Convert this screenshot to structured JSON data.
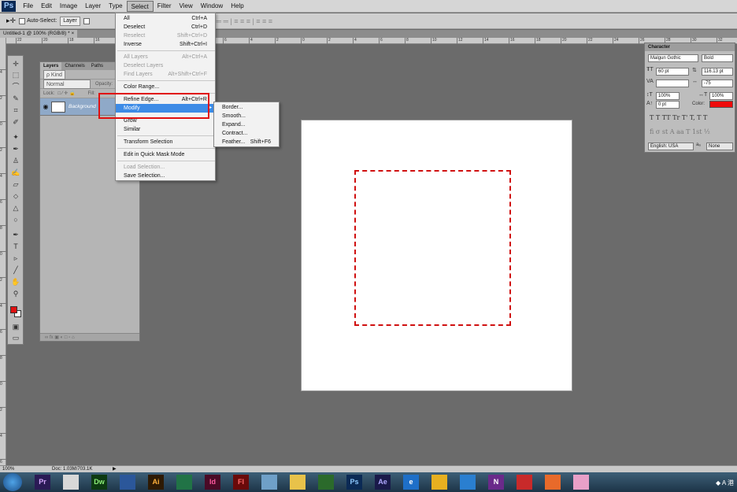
{
  "app": {
    "logo": "Ps"
  },
  "menubar": [
    "File",
    "Edit",
    "Image",
    "Layer",
    "Type",
    "Select",
    "Filter",
    "View",
    "Window",
    "Help"
  ],
  "options": {
    "auto_select": "Auto-Select:",
    "layer": "Layer",
    "align_glyphs": "═ ═ ═ | ≡ ≡ ≡ | ≡ ≡ ≡"
  },
  "document": {
    "tab_title": "Untitled-1 @ 100% (RGB/8) *",
    "close": "×"
  },
  "ruler_top": [
    "22",
    "20",
    "18",
    "16",
    "6",
    "4",
    "2",
    "0",
    "2",
    "4",
    "6",
    "8",
    "10",
    "12",
    "14",
    "16",
    "18",
    "20",
    "22",
    "24",
    "26",
    "28",
    "30",
    "32"
  ],
  "ruler_left": [
    "4",
    "2",
    "0",
    "2",
    "4",
    "6",
    "8",
    "0",
    "2",
    "4",
    "6",
    "8",
    "0",
    "2",
    "4",
    "6"
  ],
  "select_menu": {
    "items": [
      {
        "label": "All",
        "shortcut": "Ctrl+A",
        "disabled": false
      },
      {
        "label": "Deselect",
        "shortcut": "Ctrl+D",
        "disabled": false
      },
      {
        "label": "Reselect",
        "shortcut": "Shift+Ctrl+D",
        "disabled": true
      },
      {
        "label": "Inverse",
        "shortcut": "Shift+Ctrl+I",
        "disabled": false
      },
      {
        "label": "All Layers",
        "shortcut": "Alt+Ctrl+A",
        "disabled": true
      },
      {
        "label": "Deselect Layers",
        "shortcut": "",
        "disabled": true
      },
      {
        "label": "Find Layers",
        "shortcut": "Alt+Shift+Ctrl+F",
        "disabled": true
      },
      {
        "label": "Color Range...",
        "shortcut": "",
        "disabled": false
      },
      {
        "label": "Refine Edge...",
        "shortcut": "Alt+Ctrl+R",
        "disabled": false
      },
      {
        "label": "Modify",
        "shortcut": "",
        "disabled": false
      },
      {
        "label": "Grow",
        "shortcut": "",
        "disabled": false
      },
      {
        "label": "Similar",
        "shortcut": "",
        "disabled": false
      },
      {
        "label": "Transform Selection",
        "shortcut": "",
        "disabled": false
      },
      {
        "label": "Edit in Quick Mask Mode",
        "shortcut": "",
        "disabled": false
      },
      {
        "label": "Load Selection...",
        "shortcut": "",
        "disabled": true
      },
      {
        "label": "Save Selection...",
        "shortcut": "",
        "disabled": false
      }
    ],
    "submenu_arrow": "▶"
  },
  "modify_submenu": [
    {
      "label": "Border...",
      "shortcut": ""
    },
    {
      "label": "Smooth...",
      "shortcut": ""
    },
    {
      "label": "Expand...",
      "shortcut": ""
    },
    {
      "label": "Contract...",
      "shortcut": ""
    },
    {
      "label": "Feather...",
      "shortcut": "Shift+F6"
    }
  ],
  "layers": {
    "tabs": [
      "Layers",
      "Channels",
      "Paths"
    ],
    "kind": "ρ Kind",
    "blend": "Normal",
    "opacity": "Opacity:",
    "lock": "Lock:",
    "fill": "Fill:",
    "layer_name": "Background",
    "footer": "∞  fx  ▣  ◐  □  ▫  ⌂"
  },
  "character": {
    "title": "Character",
    "font": "Malgun Gothic",
    "style": "Bold",
    "size": "60 pt",
    "leading": "116.13 pt",
    "kerning": "",
    "tracking": "-75",
    "vscale": "100%",
    "hscale": "100%",
    "baseline": "0 pt",
    "color_label": "Color:",
    "color": "#ee0a0a",
    "typo_row1": "T  T  TT  Tr  T'  T,  T  T",
    "typo_row2": "fi  σ  st  A  aa  T  1st  ½",
    "language": "English: USA",
    "aa_label": "aₐ",
    "aa": "None"
  },
  "status": {
    "zoom": "100%",
    "doc": "Doc: 1.03M/703.1K"
  },
  "taskbar": [
    {
      "label": "Pr",
      "color": "#2a1a55",
      "fg": "#d5a8ff"
    },
    {
      "label": "",
      "color": "#d8d8d8",
      "fg": "#c00"
    },
    {
      "label": "Dw",
      "color": "#0d3a12",
      "fg": "#8df07a"
    },
    {
      "label": "",
      "color": "#2b579a",
      "fg": "#fff"
    },
    {
      "label": "Ai",
      "color": "#2e1a04",
      "fg": "#ffb13b"
    },
    {
      "label": "",
      "color": "#217346",
      "fg": "#fff"
    },
    {
      "label": "Id",
      "color": "#4a0a26",
      "fg": "#ff5aa0"
    },
    {
      "label": "Fl",
      "color": "#6a0a0a",
      "fg": "#ff6a6a"
    },
    {
      "label": "",
      "color": "#6fa0c8",
      "fg": "#fff"
    },
    {
      "label": "",
      "color": "#e8c24a",
      "fg": "#fff"
    },
    {
      "label": "",
      "color": "#2b6a2b",
      "fg": "#fff"
    },
    {
      "label": "Ps",
      "color": "#0b2a55",
      "fg": "#8cc8ff"
    },
    {
      "label": "Ae",
      "color": "#1a1a4a",
      "fg": "#b0a8ff"
    },
    {
      "label": "e",
      "color": "#1e6fc8",
      "fg": "#fff"
    },
    {
      "label": "",
      "color": "#e8b020",
      "fg": "#fff"
    },
    {
      "label": "",
      "color": "#2a7fd0",
      "fg": "#fff"
    },
    {
      "label": "N",
      "color": "#6a2a8a",
      "fg": "#fff"
    },
    {
      "label": "",
      "color": "#c82a2a",
      "fg": "#fff"
    },
    {
      "label": "",
      "color": "#e86a2a",
      "fg": "#fff"
    },
    {
      "label": "",
      "color": "#e8a0c8",
      "fg": "#fff"
    }
  ],
  "tray": "◆ A 港"
}
